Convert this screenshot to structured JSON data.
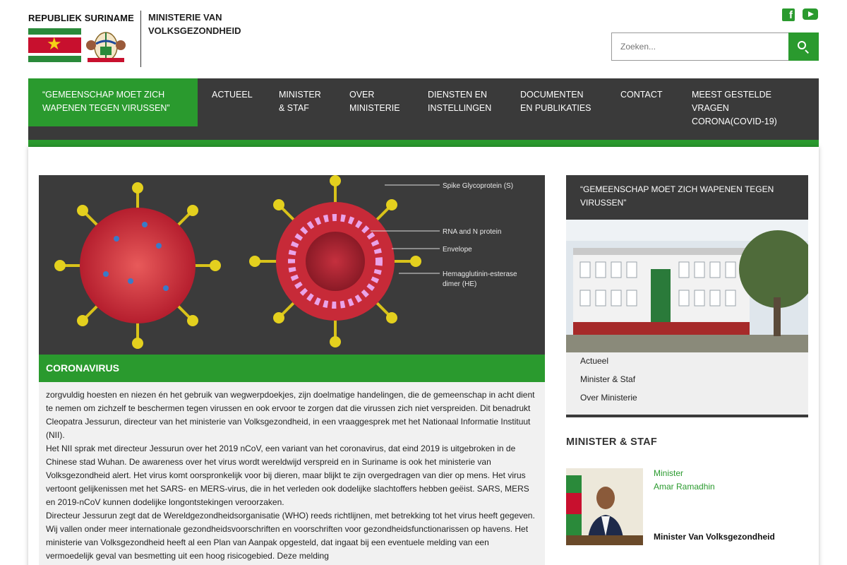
{
  "header": {
    "logo_text": "REPUBLIEK SURINAME",
    "ministry_line1": "MINISTERIE VAN",
    "ministry_line2": "VOLKSGEZONDHEID",
    "search_placeholder": "Zoeken...",
    "social": [
      "facebook-icon",
      "youtube-icon"
    ]
  },
  "nav": {
    "items": [
      {
        "line1": "“GEMEENSCHAP MOET ZICH",
        "line2": "WAPENEN TEGEN VIRUSSEN”",
        "line3": "",
        "active": true
      },
      {
        "line1": "ACTUEEL",
        "line2": "",
        "line3": ""
      },
      {
        "line1": "MINISTER",
        "line2": "& STAF",
        "line3": ""
      },
      {
        "line1": "OVER",
        "line2": "MINISTERIE",
        "line3": ""
      },
      {
        "line1": "DIENSTEN EN",
        "line2": "INSTELLINGEN",
        "line3": ""
      },
      {
        "line1": "DOCUMENTEN",
        "line2": "EN PUBLIKATIES",
        "line3": ""
      },
      {
        "line1": "CONTACT",
        "line2": "",
        "line3": ""
      },
      {
        "line1": "MEEST GESTELDE",
        "line2": "VRAGEN",
        "line3": "CORONA(COVID-19)"
      }
    ]
  },
  "hero": {
    "labels": [
      "Spike Glycoprotein (S)",
      "RNA and N protein",
      "Envelope",
      "Hemagglutinin-esterase",
      "dimer (HE)"
    ]
  },
  "article": {
    "title": "CORONAVIRUS",
    "paragraphs": [
      "zorgvuldig hoesten en niezen én het gebruik van wegwerpdoekjes, zijn doelmatige handelingen, die de gemeenschap in acht dient te nemen om zichzelf te beschermen tegen virussen en ook ervoor te zorgen dat die virussen zich niet verspreiden. Dit benadrukt Cleopatra Jessurun, directeur van het ministerie van Volksgezondheid, in een vraaggesprek met het Nationaal Informatie Instituut (NII).",
      "Het NII sprak met directeur Jessurun over het 2019 nCoV, een variant van het coronavirus, dat eind 2019 is uitgebroken in de Chinese stad Wuhan. De awareness over het virus wordt wereldwijd verspreid en in Suriname is ook het ministerie van Volksgezondheid alert. Het virus komt oorspronkelijk voor bij dieren, maar blijkt te zijn overgedragen van dier op mens. Het virus vertoont gelijkenissen met het SARS- en MERS-virus, die in het verleden ook dodelijke slachtoffers hebben geëist. SARS, MERS en 2019-nCoV kunnen dodelijke longontstekingen veroorzaken.",
      "Directeur Jessurun zegt dat de Wereldgezondheidsorganisatie (WHO) reeds richtlijnen, met betrekking tot het virus heeft gegeven. Wij vallen onder meer internationale gezondheidsvoorschriften en voorschriften voor gezondheidsfunctionarissen op havens. Het ministerie van Volksgezondheid heeft al een Plan van Aanpak opgesteld, dat ingaat bij een eventuele melding van een vermoedelijk geval van besmetting uit een hoog risicogebied. Deze melding"
    ]
  },
  "sidebar": {
    "heading": "“GEMEENSCHAP MOET ZICH WAPENEN TEGEN VIRUSSEN”",
    "links": [
      "Actueel",
      "Minister & Staf",
      "Over Ministerie"
    ],
    "minister_section": "MINISTER & STAF",
    "minister_role": "Minister",
    "minister_name": "Amar Ramadhin",
    "minister_title": "Minister Van Volksgezondheid"
  },
  "colors": {
    "accent": "#2a9a2e",
    "nav_bg": "#3a3a3a"
  }
}
